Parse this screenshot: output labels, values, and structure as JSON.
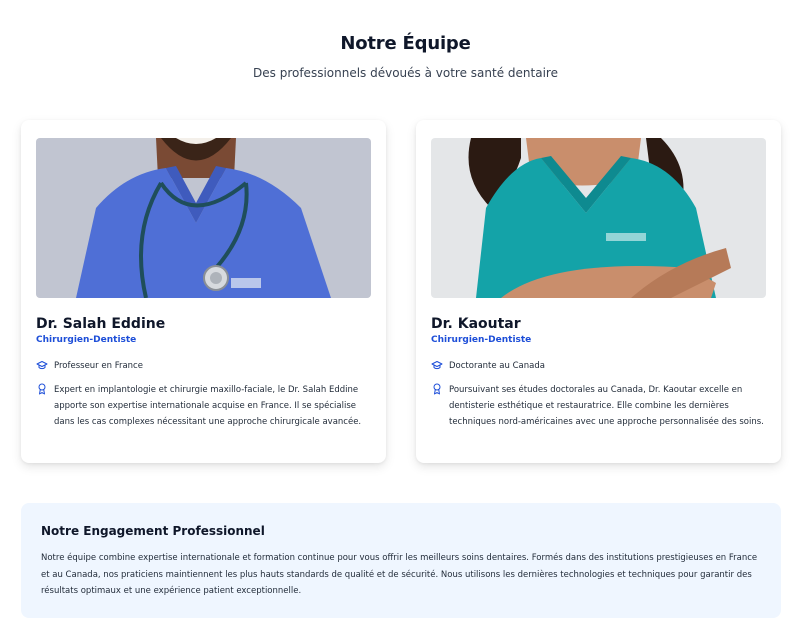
{
  "header": {
    "title": "Notre Équipe",
    "subtitle": "Des professionnels dévoués à votre santé dentaire"
  },
  "team": [
    {
      "name": "Dr. Salah Eddine",
      "role": "Chirurgien-Dentiste",
      "education": "Professeur en France",
      "description": "Expert en implantologie et chirurgie maxillo-faciale, le Dr. Salah Eddine apporte son expertise internationale acquise en France. Il se spécialise dans les cas complexes nécessitant une approche chirurgicale avancée.",
      "photo_icon": "doctor-photo",
      "scrubs_color": "#4f6fd6"
    },
    {
      "name": "Dr. Kaoutar",
      "role": "Chirurgien-Dentiste",
      "education": "Doctorante au Canada",
      "description": "Poursuivant ses études doctorales au Canada, Dr. Kaoutar excelle en dentisterie esthétique et restauratrice. Elle combine les dernières techniques nord-américaines avec une approche personnalisée des soins.",
      "photo_icon": "doctor-photo",
      "scrubs_color": "#14a3a8"
    }
  ],
  "commitment": {
    "title": "Notre Engagement Professionnel",
    "text": "Notre équipe combine expertise internationale et formation continue pour vous offrir les meilleurs soins dentaires. Formés dans des institutions prestigieuses en France et au Canada, nos praticiens maintiennent les plus hauts standards de qualité et de sécurité. Nous utilisons les dernières technologies et techniques pour garantir des résultats optimaux et une expérience patient exceptionnelle."
  },
  "colors": {
    "accent": "#1d4ed8",
    "commitment_bg": "#eff6ff"
  },
  "icons": {
    "education": "graduation-cap-icon",
    "award": "award-icon"
  }
}
